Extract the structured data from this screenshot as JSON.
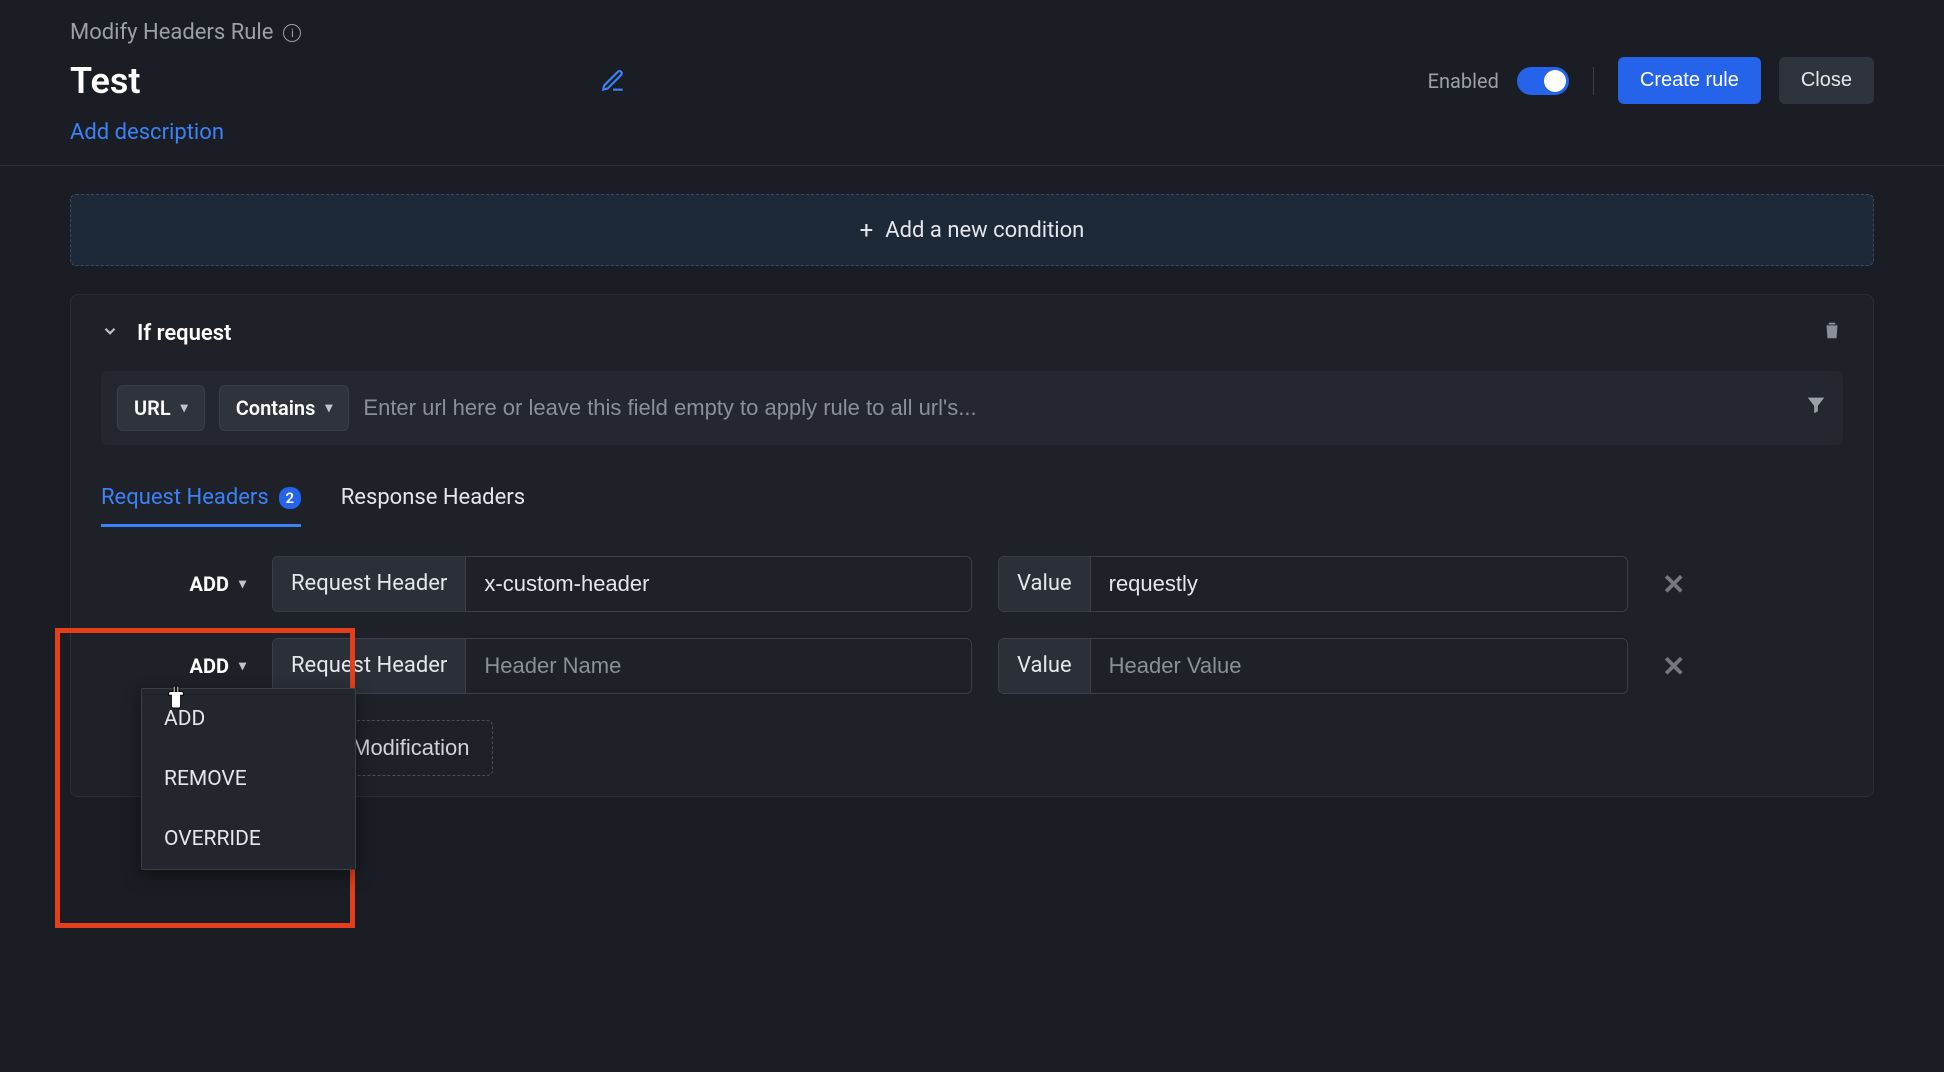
{
  "breadcrumb": {
    "title": "Modify Headers Rule"
  },
  "rule": {
    "name": "Test",
    "addDescription": "Add description",
    "enabledLabel": "Enabled",
    "createRule": "Create rule",
    "close": "Close"
  },
  "addCondition": "Add a new condition",
  "panel": {
    "title": "If request",
    "urlPill": "URL",
    "operatorPill": "Contains",
    "urlPlaceholder": "Enter url here or leave this field empty to apply rule to all url's..."
  },
  "tabs": {
    "request": "Request Headers",
    "requestBadge": "2",
    "response": "Response Headers"
  },
  "modRows": [
    {
      "action": "ADD",
      "keyLabel": "Request Header",
      "keyValue": "x-custom-header",
      "keyPlaceholder": "Header Name",
      "valLabel": "Value",
      "valValue": "requestly",
      "valPlaceholder": "Header Value"
    },
    {
      "action": "ADD",
      "keyLabel": "Request Header",
      "keyValue": "",
      "keyPlaceholder": "Header Name",
      "valLabel": "Value",
      "valValue": "",
      "valPlaceholder": "Header Value"
    }
  ],
  "addModification": "Add Modification",
  "dropdown": {
    "add": "ADD",
    "remove": "REMOVE",
    "override": "OVERRIDE"
  }
}
